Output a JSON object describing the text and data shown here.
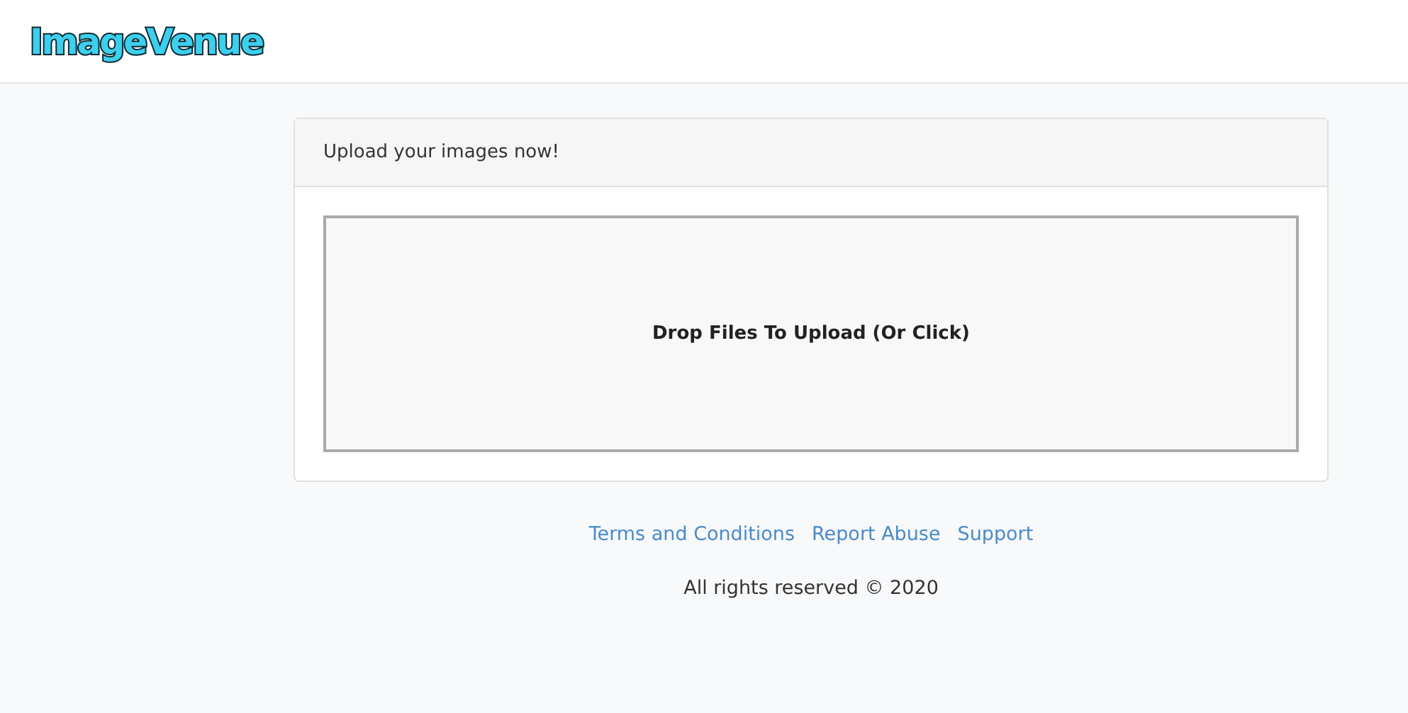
{
  "header": {
    "logo": "ImageVenue"
  },
  "upload_card": {
    "title": "Upload your images now!",
    "dropzone": {
      "label": "Drop Files To Upload (Or Click)"
    }
  },
  "footer": {
    "links": [
      "Terms and Conditions",
      "Report Abuse",
      "Support"
    ],
    "copyright": "All rights reserved © 2020"
  }
}
